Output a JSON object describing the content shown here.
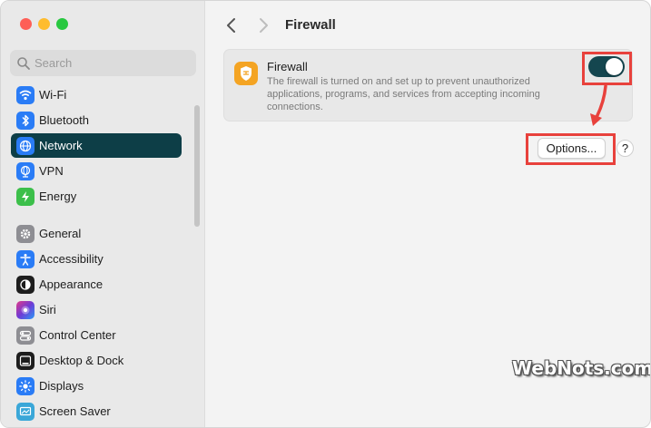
{
  "window": {
    "traffic_lights": [
      "close",
      "minimize",
      "zoom"
    ]
  },
  "search": {
    "placeholder": "Search"
  },
  "sidebar": {
    "items": [
      {
        "label": "Wi-Fi",
        "icon": "wifi-icon",
        "color": "#2a7cf6",
        "selected": false
      },
      {
        "label": "Bluetooth",
        "icon": "bluetooth-icon",
        "color": "#2a7cf6",
        "selected": false
      },
      {
        "label": "Network",
        "icon": "globe-icon",
        "color": "#2a7cf6",
        "selected": true
      },
      {
        "label": "VPN",
        "icon": "vpn-globe-icon",
        "color": "#2a7cf6",
        "selected": false
      },
      {
        "label": "Energy",
        "icon": "bolt-icon",
        "color": "#3cbf4a",
        "selected": false
      },
      {
        "label": "General",
        "icon": "gear-icon",
        "color": "#8e8e93",
        "selected": false
      },
      {
        "label": "Accessibility",
        "icon": "accessibility-icon",
        "color": "#2a7cf6",
        "selected": false
      },
      {
        "label": "Appearance",
        "icon": "appearance-icon",
        "color": "#1d1d1d",
        "selected": false
      },
      {
        "label": "Siri",
        "icon": "siri-icon",
        "color": "#6e3bd6",
        "selected": false
      },
      {
        "label": "Control Center",
        "icon": "control-center-icon",
        "color": "#8e8e93",
        "selected": false
      },
      {
        "label": "Desktop & Dock",
        "icon": "dock-icon",
        "color": "#1d1d1d",
        "selected": false
      },
      {
        "label": "Displays",
        "icon": "sun-icon",
        "color": "#2a7cf6",
        "selected": false
      },
      {
        "label": "Screen Saver",
        "icon": "screen-saver-icon",
        "color": "#3aa7d8",
        "selected": false
      }
    ]
  },
  "header": {
    "title": "Firewall"
  },
  "firewall": {
    "title": "Firewall",
    "description": "The firewall is turned on and set up to prevent unauthorized applications, programs, and services from accepting incoming connections.",
    "enabled": true,
    "icon": "firewall-icon",
    "accent": "#14464f"
  },
  "actions": {
    "options_label": "Options...",
    "help_label": "?"
  },
  "watermark": {
    "text": "WebNots.com"
  },
  "annotation": {
    "color": "#e8413c"
  }
}
